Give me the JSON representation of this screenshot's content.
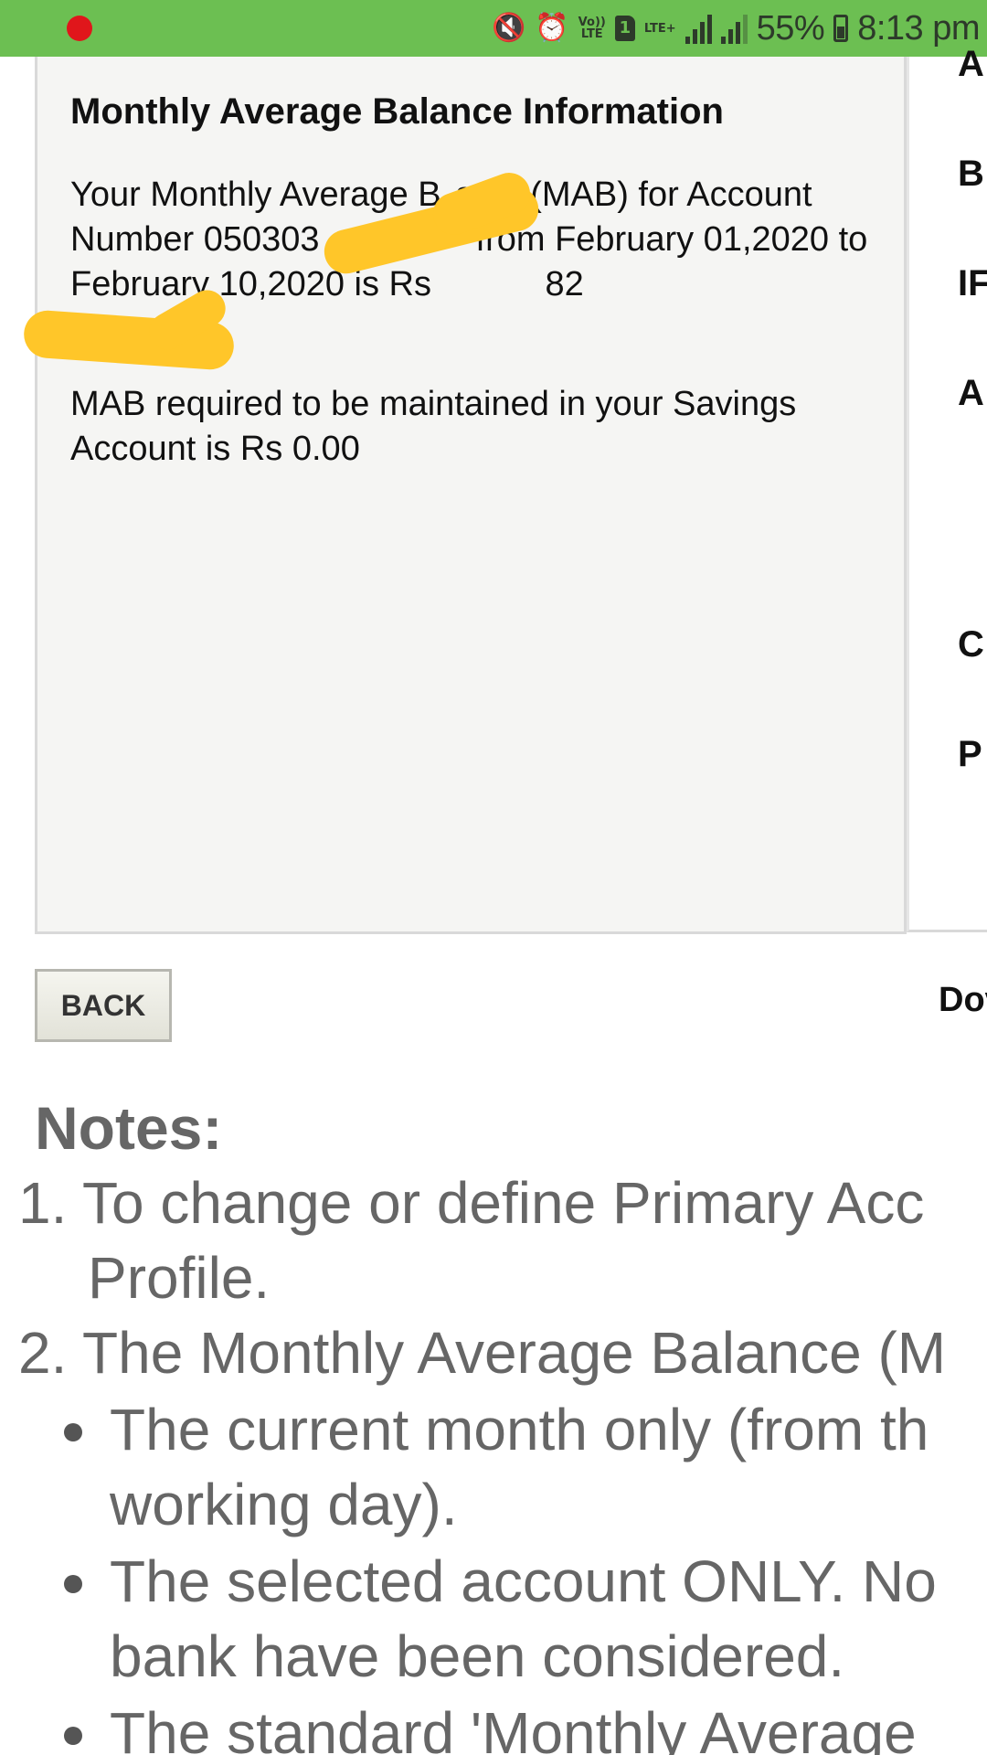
{
  "status_bar": {
    "battery_percent": "55%",
    "time": "8:13 pm",
    "volte_label_top": "Vo))",
    "volte_label_bottom": "LTE",
    "sim_number": "1",
    "network_type": "LTE+",
    "icons": [
      "recording-dot",
      "mute-icon",
      "alarm-icon",
      "volte-icon",
      "sim-icon",
      "signal-icon",
      "battery-icon"
    ]
  },
  "info": {
    "title": "Monthly Average Balance Information",
    "para1": "Your Monthly Average B  ance(MAB) for Account Number 050303         from February 01,2020 to February 10,2020 is Rs       82",
    "para2": "MAB required to be maintained in your Savings Account is Rs 0.00",
    "redaction_color": "#ffc629"
  },
  "side_panel": {
    "labels": [
      "A",
      "B",
      "IF",
      "A",
      "C",
      "P"
    ]
  },
  "actions": {
    "back_label": "BACK",
    "download_label": "Dov"
  },
  "notes": {
    "heading": "Notes:",
    "item1_line1": "1. To change or define Primary Acc",
    "item1_line2": "Profile.",
    "item2_line1": "2. The Monthly Average Balance (M",
    "bullet1_line1": "The current month only (from th",
    "bullet1_line2": "working day).",
    "bullet2_line1": "The selected account ONLY. No",
    "bullet2_line2": "bank have been considered.",
    "bullet3_line1": "The standard 'Monthly Average"
  },
  "colors": {
    "status_bar": "#6cbf52",
    "notes_text": "#666666",
    "panel_bg": "#f5f5f3"
  }
}
